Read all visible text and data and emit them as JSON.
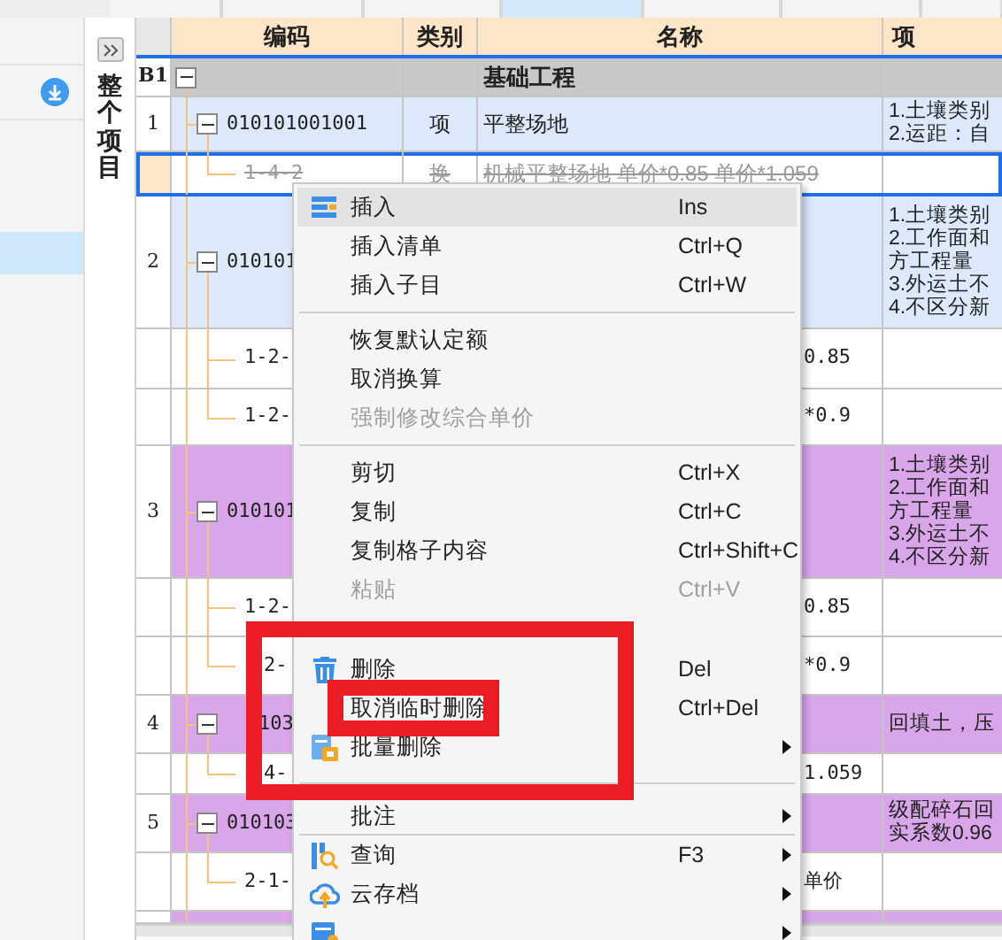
{
  "tabs": [
    {
      "selected": false
    },
    {
      "selected": false
    },
    {
      "selected": false
    },
    {
      "selected": true
    },
    {
      "selected": false
    },
    {
      "selected": false
    },
    {
      "selected": false
    }
  ],
  "side_panel": {
    "items": [
      {
        "selected": false
      },
      {
        "selected": true
      }
    ]
  },
  "scope_label": "整个项目",
  "table": {
    "columns": [
      "编码",
      "类别",
      "名称",
      "项"
    ],
    "rows": [
      {
        "kind": "group",
        "no": "B1",
        "name": "基础工程"
      },
      {
        "kind": "item",
        "no": "1",
        "code": "010101001001",
        "type": "项",
        "name": "平整场地",
        "features": [
          "1.土壤类别",
          "2.运距：自"
        ],
        "color": "#dde9fb"
      },
      {
        "kind": "sub",
        "code": "1-4-2",
        "type": "换",
        "name": "机械平整场地 单价*0.85 单价*1.059",
        "struck": true,
        "selected": true
      },
      {
        "kind": "item",
        "no": "2",
        "code": "010101",
        "features": [
          "1.土壤类别",
          "2.工作面和",
          "方工程量",
          "3.外运土不",
          "4.不区分新"
        ],
        "color": "#dde9fb"
      },
      {
        "kind": "sub",
        "code": "1-2-",
        "name": "0.85",
        "struck": false,
        "selected": false
      },
      {
        "kind": "sub",
        "code": "1-2-",
        "name": "*0.9",
        "struck": false,
        "selected": false
      },
      {
        "kind": "item",
        "no": "3",
        "code": "010101",
        "features": [
          "1.土壤类别",
          "2.工作面和",
          "方工程量",
          "3.外运土不",
          "4.不区分新"
        ],
        "color": "#d9a6ea"
      },
      {
        "kind": "sub",
        "code": "1-2-",
        "name": "0.85",
        "struck": false,
        "selected": false
      },
      {
        "kind": "sub",
        "code": "2-",
        "name": "*0.9",
        "struck": false,
        "selected": false
      },
      {
        "kind": "item",
        "no": "4",
        "code": "103",
        "features": [
          "回填土，压"
        ],
        "color": "#d9a6ea"
      },
      {
        "kind": "sub",
        "code": "4-",
        "name": "1.059",
        "struck": false,
        "selected": false
      },
      {
        "kind": "item",
        "no": "5",
        "code": "010103",
        "features": [
          "级配碎石回",
          "实系数0.96"
        ],
        "color": "#d9a6ea"
      },
      {
        "kind": "sub",
        "code": "2-1-",
        "name": "单价",
        "struck": false,
        "selected": false
      },
      {
        "kind": "item",
        "color": "#d9a6ea"
      }
    ]
  },
  "context_menu": [
    {
      "kind": "item",
      "label": "插入",
      "shortcut": "Ins",
      "disabled": false,
      "highlighted": true,
      "submenu": false
    },
    {
      "kind": "item",
      "label": "插入清单",
      "shortcut": "Ctrl+Q",
      "disabled": false,
      "highlighted": false,
      "submenu": false
    },
    {
      "kind": "item",
      "label": "插入子目",
      "shortcut": "Ctrl+W",
      "disabled": false,
      "highlighted": false,
      "submenu": false
    },
    {
      "kind": "separator"
    },
    {
      "kind": "item",
      "label": "恢复默认定额",
      "disabled": false,
      "highlighted": false,
      "submenu": false
    },
    {
      "kind": "item",
      "label": "取消换算",
      "disabled": false,
      "highlighted": false,
      "submenu": false
    },
    {
      "kind": "item",
      "label": "强制修改综合单价",
      "disabled": true,
      "highlighted": false,
      "submenu": false
    },
    {
      "kind": "separator"
    },
    {
      "kind": "item",
      "label": "剪切",
      "shortcut": "Ctrl+X",
      "disabled": false,
      "highlighted": false,
      "submenu": false
    },
    {
      "kind": "item",
      "label": "复制",
      "shortcut": "Ctrl+C",
      "disabled": false,
      "highlighted": false,
      "submenu": false
    },
    {
      "kind": "item",
      "label": "复制格子内容",
      "shortcut": "Ctrl+Shift+C",
      "disabled": false,
      "highlighted": false,
      "submenu": false
    },
    {
      "kind": "item",
      "label": "粘贴",
      "shortcut": "Ctrl+V",
      "disabled": true,
      "highlighted": false,
      "submenu": false
    },
    {
      "kind": "covered"
    },
    {
      "kind": "item",
      "label": "删除",
      "shortcut": "Del",
      "disabled": false,
      "highlighted": false,
      "submenu": false
    },
    {
      "kind": "item",
      "label": "取消临时删除",
      "shortcut": "Ctrl+Del",
      "disabled": false,
      "highlighted": false,
      "submenu": false
    },
    {
      "kind": "item",
      "label": "批量删除",
      "disabled": false,
      "highlighted": false,
      "submenu": true
    },
    {
      "kind": "separator"
    },
    {
      "kind": "item",
      "label": "批注",
      "disabled": false,
      "highlighted": false,
      "submenu": true
    },
    {
      "kind": "separator"
    },
    {
      "kind": "item",
      "label": "查询",
      "shortcut": "F3",
      "disabled": false,
      "highlighted": false,
      "submenu": true
    },
    {
      "kind": "item",
      "label": "云存档",
      "disabled": false,
      "highlighted": false,
      "submenu": true
    },
    {
      "kind": "item",
      "disabled": false,
      "highlighted": false,
      "submenu": true
    }
  ]
}
